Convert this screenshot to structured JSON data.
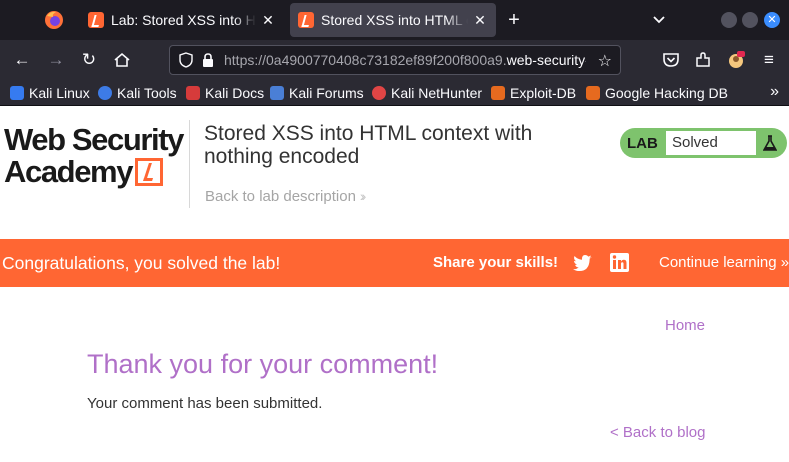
{
  "browser": {
    "tabs": [
      {
        "title": "Lab: Stored XSS into HTML context with nothing encoded",
        "active": false
      },
      {
        "title": "Stored XSS into HTML context with nothing encoded",
        "active": true
      }
    ],
    "url_main": "https://0a4900770408c73182ef89f200f800a9.",
    "url_host": "web-security-academy.net",
    "bookmarks": [
      {
        "label": "Kali Linux",
        "color": "#367bf0"
      },
      {
        "label": "Kali Tools",
        "color": "#3d7be6"
      },
      {
        "label": "Kali Docs",
        "color": "#d63b3b"
      },
      {
        "label": "Kali Forums",
        "color": "#4a7fd6"
      },
      {
        "label": "Kali NetHunter",
        "color": "#e04545"
      },
      {
        "label": "Exploit-DB",
        "color": "#e66a1f"
      },
      {
        "label": "Google Hacking DB",
        "color": "#e66a1f"
      }
    ]
  },
  "page": {
    "logo_line1": "Web Security",
    "logo_line2": "Academy",
    "lab_title": "Stored XSS into HTML context with nothing encoded",
    "back_to_description": "Back to lab description",
    "lab_badge": "LAB",
    "lab_status": "Solved",
    "banner": {
      "congrats": "Congratulations, you solved the lab!",
      "share": "Share your skills!",
      "continue": "Continue learning"
    },
    "home": "Home",
    "heading": "Thank you for your comment!",
    "message": "Your comment has been submitted.",
    "back_to_blog": "< Back to blog"
  },
  "colors": {
    "accent": "#ff6633",
    "solved_green": "#7ec36d",
    "link_purple": "#b070c8"
  }
}
